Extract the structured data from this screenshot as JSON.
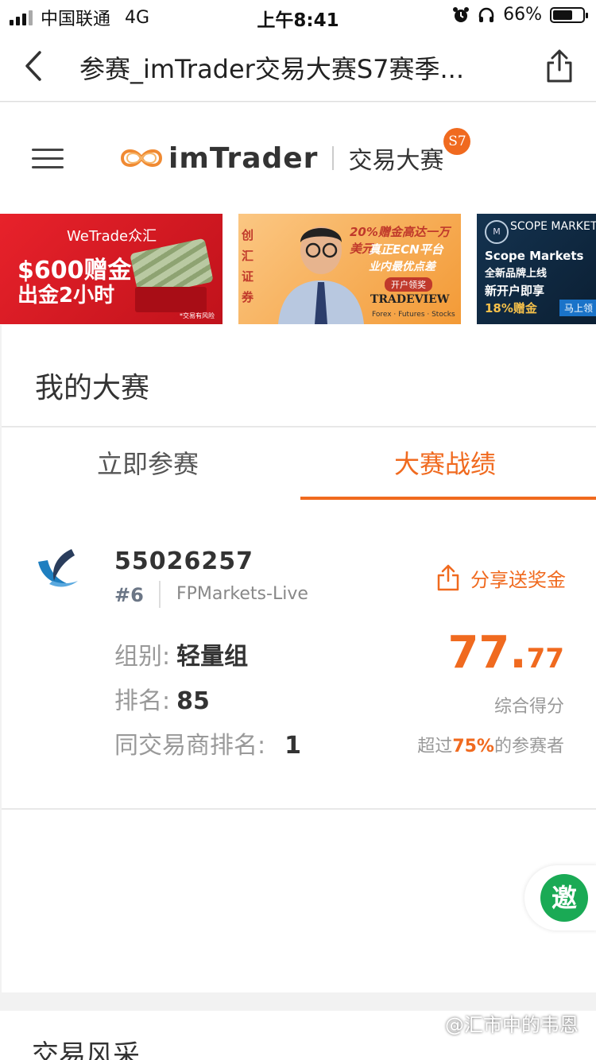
{
  "status_bar": {
    "carrier": "中国联通",
    "network": "4G",
    "time": "上午8:41",
    "battery": "66%",
    "battery_level": 0.66
  },
  "nav": {
    "title": "参赛_imTrader交易大赛S7赛季..."
  },
  "header": {
    "logo_text": "imTrader",
    "subtitle": "交易大赛",
    "season_badge": "S7"
  },
  "banners": [
    {
      "brand": "WeTrade众汇",
      "line1": "$600赠金",
      "line2": "出金2小时",
      "note": "*交易有风险"
    },
    {
      "side": "创汇证券",
      "line1": "20%赠金高达一万美元",
      "line2": "真正ECN平台",
      "line3": "业内最优点差",
      "cta": "开户领奖",
      "brand": "TRADEVIEW",
      "sub": "Forex · Futures · Stocks"
    },
    {
      "brand": "SCOPE MARKETS",
      "line1": "Scope Markets",
      "line2": "全新品牌上线",
      "line3": "新开户即享",
      "line4": "18%赠金",
      "cta": "马上领"
    }
  ],
  "contest": {
    "title": "我的大赛",
    "tabs": [
      {
        "label": "立即参赛",
        "active": false
      },
      {
        "label": "大赛战绩",
        "active": true
      }
    ],
    "result": {
      "account": "55026257",
      "rank_no": "#6",
      "server": "FPMarkets-Live",
      "share_label": "分享送奖金",
      "group_label": "组别:",
      "group_value": "轻量组",
      "rank_label": "排名:",
      "rank_value": "85",
      "broker_rank_label": "同交易商排名:",
      "broker_rank_value": "1",
      "score_int": "77.",
      "score_dec": "77",
      "score_label": "综合得分",
      "beat_prefix": "超过",
      "beat_pct": "75%",
      "beat_suffix": "的参赛者"
    },
    "invite_label": "邀"
  },
  "next_section": {
    "title": "交易风采"
  },
  "watermark": "@汇市中的韦恩",
  "colors": {
    "accent": "#f06a1f",
    "invite": "#1aaa55"
  }
}
